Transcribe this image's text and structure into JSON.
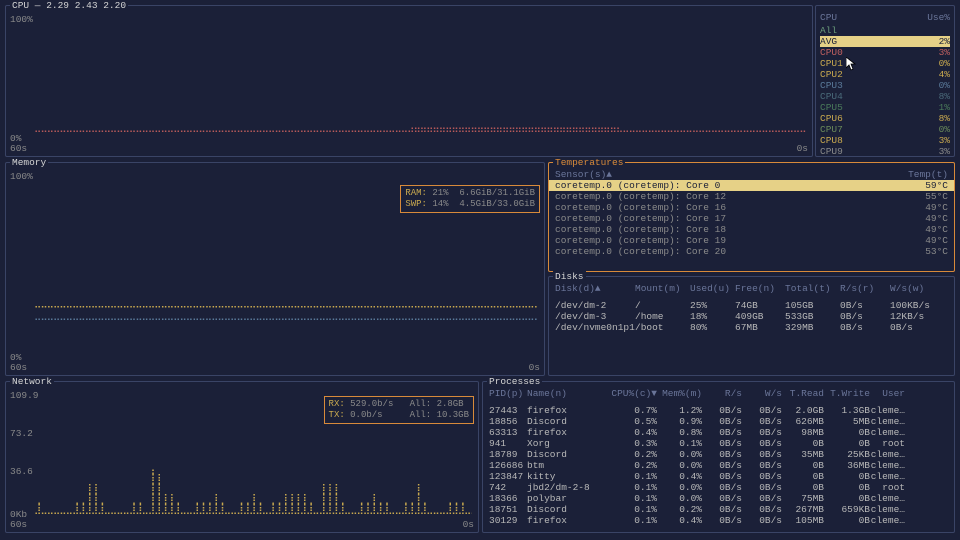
{
  "cpu": {
    "title": "CPU — 2.29 2.43 2.20",
    "scale_top": "100%",
    "scale_bot": "0%",
    "time_l": "60s",
    "time_r": "0s",
    "table_hdr": {
      "name": "CPU",
      "use": "Use%"
    },
    "all_label": "All",
    "avg": {
      "label": "AVG",
      "value": "2%"
    },
    "rows": [
      {
        "label": "CPU0",
        "value": "3%",
        "color": "#c06060"
      },
      {
        "label": "CPU1",
        "value": "0%",
        "color": "#c9a94f"
      },
      {
        "label": "CPU2",
        "value": "4%",
        "color": "#c9a94f"
      },
      {
        "label": "CPU3",
        "value": "0%",
        "color": "#5a7a9a"
      },
      {
        "label": "CPU4",
        "value": "8%",
        "color": "#4a6a7a"
      },
      {
        "label": "CPU5",
        "value": "1%",
        "color": "#4a7a5a"
      },
      {
        "label": "CPU6",
        "value": "8%",
        "color": "#c9a94f"
      },
      {
        "label": "CPU7",
        "value": "0%",
        "color": "#6a8a5a"
      },
      {
        "label": "CPU8",
        "value": "3%",
        "color": "#c9a94f"
      },
      {
        "label": "CPU9",
        "value": "3%",
        "color": "#8a8a8a"
      }
    ]
  },
  "memory": {
    "title": "Memory",
    "scale_top": "100%",
    "scale_bot": "0%",
    "time_l": "60s",
    "time_r": "0s",
    "ram_label": "RAM:",
    "ram_pct": "21%",
    "ram_val": "6.6GiB/31.1GiB",
    "swp_label": "SWP:",
    "swp_pct": "14%",
    "swp_val": "4.5GiB/33.0GiB"
  },
  "temps": {
    "title": "Temperatures",
    "hdr_sensor": "Sensor(s)▲",
    "hdr_temp": "Temp(t)",
    "rows": [
      {
        "sensor": "coretemp.0 (coretemp): Core 0",
        "temp": "59°C",
        "hl": true
      },
      {
        "sensor": "coretemp.0 (coretemp): Core 12",
        "temp": "55°C"
      },
      {
        "sensor": "coretemp.0 (coretemp): Core 16",
        "temp": "49°C"
      },
      {
        "sensor": "coretemp.0 (coretemp): Core 17",
        "temp": "49°C"
      },
      {
        "sensor": "coretemp.0 (coretemp): Core 18",
        "temp": "49°C"
      },
      {
        "sensor": "coretemp.0 (coretemp): Core 19",
        "temp": "49°C"
      },
      {
        "sensor": "coretemp.0 (coretemp): Core 20",
        "temp": "53°C"
      }
    ]
  },
  "disks": {
    "title": "Disks",
    "hdr": {
      "disk": "Disk(d)▲",
      "mount": "Mount(m)",
      "used": "Used(u)",
      "free": "Free(n)",
      "total": "Total(t)",
      "rs": "R/s(r)",
      "ws": "W/s(w)"
    },
    "rows": [
      {
        "disk": "/dev/dm-2",
        "mount": "/",
        "used": "25%",
        "free": "74GB",
        "total": "105GB",
        "rs": "0B/s",
        "ws": "100KB/s"
      },
      {
        "disk": "/dev/dm-3",
        "mount": "/home",
        "used": "18%",
        "free": "409GB",
        "total": "533GB",
        "rs": "0B/s",
        "ws": "12KB/s"
      },
      {
        "disk": "/dev/nvme0n1p1",
        "mount": "/boot",
        "used": "80%",
        "free": "67MB",
        "total": "329MB",
        "rs": "0B/s",
        "ws": "0B/s"
      }
    ]
  },
  "network": {
    "title": "Network",
    "scale_top": "109.9",
    "scale_mid1": "73.2",
    "scale_mid2": "36.6",
    "scale_bot": "0Kb",
    "time_l": "60s",
    "time_r": "0s",
    "rx_label": "RX:",
    "rx_val": "529.0b/s",
    "rx_all": "All:  2.8GB",
    "tx_label": "TX:",
    "tx_val": "0.0b/s",
    "tx_all": "All: 10.3GB"
  },
  "procs": {
    "title": "Processes",
    "hdr": {
      "pid": "PID(p)",
      "name": "Name(n)",
      "cpu": "CPU%(c)▼",
      "mem": "Mem%(m)",
      "rs": "R/s",
      "ws": "W/s",
      "tr": "T.Read",
      "tw": "T.Write",
      "user": "User"
    },
    "rows": [
      {
        "pid": "27443",
        "name": "firefox",
        "cpu": "0.7%",
        "mem": "1.2%",
        "rs": "0B/s",
        "ws": "0B/s",
        "tr": "2.0GB",
        "tw": "1.3GB",
        "user": "cleme…"
      },
      {
        "pid": "18856",
        "name": "Discord",
        "cpu": "0.5%",
        "mem": "0.9%",
        "rs": "0B/s",
        "ws": "0B/s",
        "tr": "626MB",
        "tw": "5MB",
        "user": "cleme…"
      },
      {
        "pid": "63313",
        "name": "firefox",
        "cpu": "0.4%",
        "mem": "0.8%",
        "rs": "0B/s",
        "ws": "0B/s",
        "tr": "98MB",
        "tw": "0B",
        "user": "cleme…"
      },
      {
        "pid": "941",
        "name": "Xorg",
        "cpu": "0.3%",
        "mem": "0.1%",
        "rs": "0B/s",
        "ws": "0B/s",
        "tr": "0B",
        "tw": "0B",
        "user": "root"
      },
      {
        "pid": "18789",
        "name": "Discord",
        "cpu": "0.2%",
        "mem": "0.0%",
        "rs": "0B/s",
        "ws": "0B/s",
        "tr": "35MB",
        "tw": "25KB",
        "user": "cleme…"
      },
      {
        "pid": "126686",
        "name": "btm",
        "cpu": "0.2%",
        "mem": "0.0%",
        "rs": "0B/s",
        "ws": "0B/s",
        "tr": "0B",
        "tw": "36MB",
        "user": "cleme…"
      },
      {
        "pid": "123847",
        "name": "kitty",
        "cpu": "0.1%",
        "mem": "0.4%",
        "rs": "0B/s",
        "ws": "0B/s",
        "tr": "0B",
        "tw": "0B",
        "user": "cleme…"
      },
      {
        "pid": "742",
        "name": "jbd2/dm-2-8",
        "cpu": "0.1%",
        "mem": "0.0%",
        "rs": "0B/s",
        "ws": "0B/s",
        "tr": "0B",
        "tw": "0B",
        "user": "root"
      },
      {
        "pid": "18366",
        "name": "polybar",
        "cpu": "0.1%",
        "mem": "0.0%",
        "rs": "0B/s",
        "ws": "0B/s",
        "tr": "75MB",
        "tw": "0B",
        "user": "cleme…"
      },
      {
        "pid": "18751",
        "name": "Discord",
        "cpu": "0.1%",
        "mem": "0.2%",
        "rs": "0B/s",
        "ws": "0B/s",
        "tr": "267MB",
        "tw": "659KB",
        "user": "cleme…"
      },
      {
        "pid": "30129",
        "name": "firefox",
        "cpu": "0.1%",
        "mem": "0.4%",
        "rs": "0B/s",
        "ws": "0B/s",
        "tr": "105MB",
        "tw": "0B",
        "user": "cleme…"
      }
    ]
  },
  "chart_data": [
    {
      "type": "line",
      "title": "CPU",
      "x_unit": "s",
      "x_range": [
        60,
        0
      ],
      "ylabel": "Use%",
      "ylim": [
        0,
        100
      ],
      "series": [
        {
          "name": "AVG",
          "approx_values_pct": [
            7,
            7,
            6,
            7,
            7,
            6,
            7,
            6,
            7,
            8,
            8,
            11,
            11,
            11,
            10,
            10,
            10,
            10,
            10,
            10,
            9,
            9,
            8,
            8,
            8,
            8,
            8,
            8,
            7,
            7,
            5,
            4,
            4,
            4,
            4,
            4,
            4,
            4,
            4,
            4,
            4,
            4,
            4
          ]
        }
      ]
    },
    {
      "type": "line",
      "title": "Memory",
      "x_unit": "s",
      "x_range": [
        60,
        0
      ],
      "ylim": [
        0,
        100
      ],
      "series": [
        {
          "name": "RAM",
          "current_pct": 21,
          "approx_trace_pct": 21
        },
        {
          "name": "SWP",
          "current_pct": 14,
          "approx_trace_pct": 14
        }
      ]
    },
    {
      "type": "line",
      "title": "Network",
      "x_unit": "s",
      "x_range": [
        60,
        0
      ],
      "y_unit": "Kb",
      "ylim": [
        0,
        109.9
      ],
      "series": [
        {
          "name": "RX",
          "current": "529.0b/s",
          "total": "2.8GB",
          "approx_peaks_kb": [
            3,
            2,
            35,
            40,
            38,
            85,
            70,
            20,
            8,
            5,
            10,
            15,
            8,
            25,
            18,
            6,
            4,
            20,
            15,
            28,
            14,
            5,
            30,
            40,
            32,
            7,
            6,
            20,
            8,
            34,
            4,
            5,
            5,
            10,
            5,
            4,
            5,
            30,
            27,
            6,
            5,
            5,
            4
          ]
        },
        {
          "name": "TX",
          "current": "0.0b/s",
          "total": "10.3GB"
        }
      ]
    }
  ]
}
